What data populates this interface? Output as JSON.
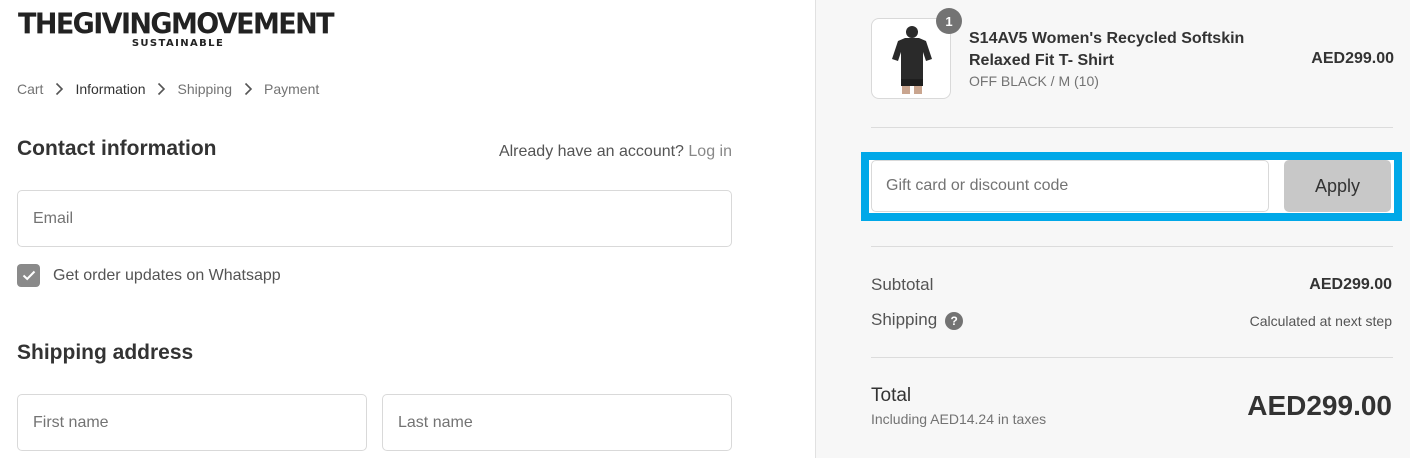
{
  "brand": {
    "name": "THEGIVINGMOVEMENT",
    "tagline": "SUSTAINABLE"
  },
  "breadcrumb": [
    {
      "label": "Cart"
    },
    {
      "label": "Information"
    },
    {
      "label": "Shipping"
    },
    {
      "label": "Payment"
    }
  ],
  "contact": {
    "title": "Contact information",
    "account_prompt": "Already have an account?",
    "login_label": "Log in",
    "email_placeholder": "Email",
    "whatsapp_label": "Get order updates on Whatsapp",
    "whatsapp_checked": true
  },
  "shipping_address": {
    "title": "Shipping address",
    "first_name_placeholder": "First name",
    "last_name_placeholder": "Last name"
  },
  "order_summary": {
    "item": {
      "quantity": "1",
      "name": "S14AV5 Women's Recycled Softskin Relaxed Fit T- Shirt",
      "variant": "OFF BLACK / M (10)",
      "price": "AED299.00"
    },
    "discount": {
      "placeholder": "Gift card or discount code",
      "apply_label": "Apply",
      "highlight_color": "#00a8e8"
    },
    "subtotal_label": "Subtotal",
    "subtotal_value": "AED299.00",
    "shipping_label": "Shipping",
    "shipping_value": "Calculated at next step",
    "total_label": "Total",
    "tax_note": "Including AED14.24 in taxes",
    "total_value": "AED299.00"
  }
}
